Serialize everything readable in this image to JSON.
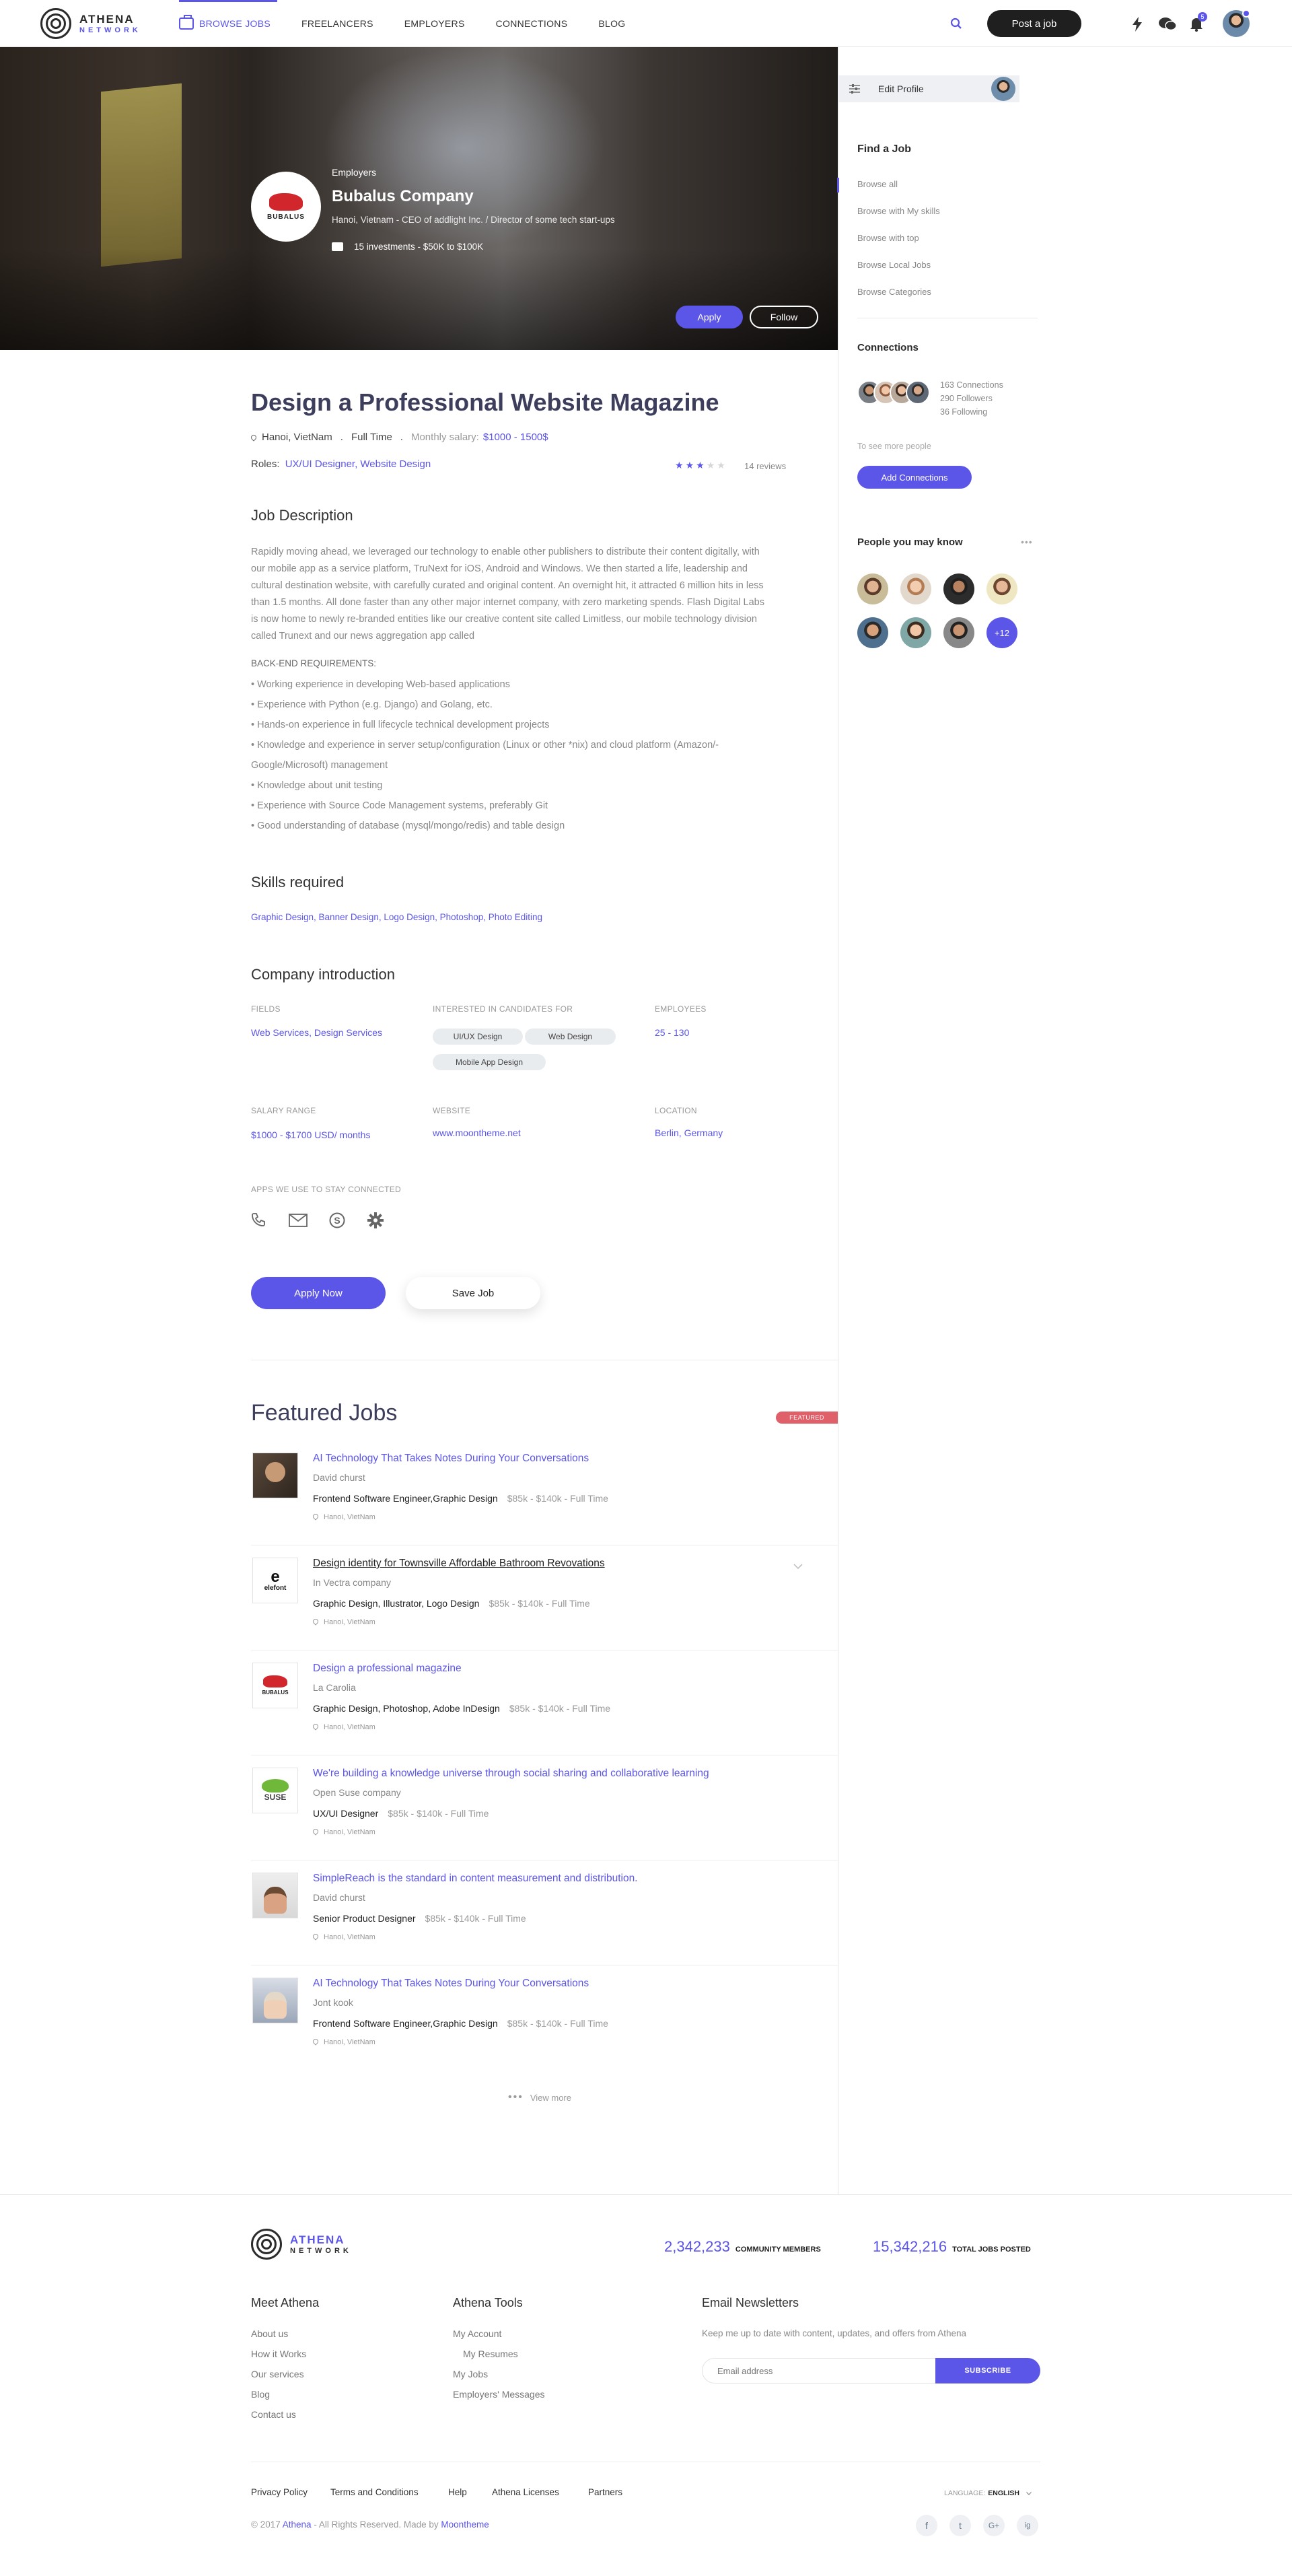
{
  "header": {
    "logo_line1": "ATHENA",
    "logo_line2": "NETWORK",
    "nav": [
      {
        "label": "BROWSE JOBS"
      },
      {
        "label": "FREELANCERS"
      },
      {
        "label": "EMPLOYERS"
      },
      {
        "label": "CONNECTIONS"
      },
      {
        "label": "BLOG"
      }
    ],
    "post_job": "Post a job",
    "notification_count": "5"
  },
  "hero": {
    "kicker": "Employers",
    "company": "Bubalus Company",
    "tagline": "Hanoi, Vietnam - CEO of addlight Inc. / Director of some tech start-ups",
    "investments": "15 investments - $50K to $100K",
    "logo_text": "BUBALUS",
    "apply": "Apply",
    "follow": "Follow"
  },
  "job": {
    "title": "Design a Professional Website Magazine",
    "location": "Hanoi, VietNam",
    "type": "Full Time",
    "salary_label": "Monthly salary:",
    "salary": "$1000 - 1500$",
    "roles_label": "Roles:",
    "roles": "UX/UI Designer, Website Design",
    "rating": 3,
    "rating_max": 5,
    "reviews": "14 reviews",
    "description_heading": "Job Description",
    "description": "Rapidly moving ahead, we leveraged our technology to enable other publishers to distribute their content digitally, with our mobile app as a service platform, TruNext for iOS, Android and Windows. We then started a life, leadership and cultural destination website, with carefully curated and original content. An overnight hit, it attracted 6 million hits in less than 1.5 months. All done faster than any other major internet company, with zero marketing spends. Flash Digital Labs is now home to newly re-branded entities like our creative content site called Limitless, our mobile technology division called Trunext and our news aggregation app called",
    "req_heading": "BACK-END REQUIREMENTS:",
    "requirements": [
      "• Working experience in developing Web-based applications",
      "• Experience with Python (e.g. Django) and Golang, etc.",
      "• Hands-on experience in full lifecycle technical development projects",
      "• Knowledge and experience in server setup/configuration (Linux or other *nix) and cloud platform (Amazon/-",
      "Google/Microsoft) management",
      "• Knowledge about unit testing",
      "• Experience with Source Code Management systems, preferably Git",
      "• Good understanding of database (mysql/mongo/redis) and table design"
    ],
    "skills_heading": "Skills required",
    "skills": "Graphic Design, Banner Design, Logo Design, Photoshop, Photo Editing"
  },
  "company_intro": {
    "heading": "Company introduction",
    "fields_label": "FIELDS",
    "fields": "Web Services, Design Services",
    "interested_label": "INTERESTED IN CANDIDATES FOR",
    "interested": [
      "UI/UX Design",
      "Web Design",
      "Mobile App Design"
    ],
    "employees_label": "EMPLOYEES",
    "employees": "25 - 130",
    "salary_label": "SALARY RANGE",
    "salary": "$1000 - $1700 USD/ months",
    "website_label": "WEBSITE",
    "website": "www.moontheme.net",
    "location_label": "LOCATION",
    "location": "Berlin, Germany",
    "apps_label": "APPS WE USE TO STAY CONNECTED",
    "apply_now": "Apply Now",
    "save_job": "Save Job"
  },
  "featured": {
    "heading": "Featured Jobs",
    "badge": "FEATURED",
    "view_more": "View more",
    "jobs": [
      {
        "title": "AI Technology That Takes Notes During Your Conversations",
        "company": "David churst",
        "skills": "Frontend Software Engineer,Graphic Design",
        "salary": "$85k - $140k - Full Time",
        "location": "Hanoi, VietNam"
      },
      {
        "title": "Design identity for Townsville Affordable Bathroom Revovations",
        "company": "In Vectra company",
        "skills": "Graphic Design, Illustrator, Logo Design",
        "salary": "$85k - $140k - Full Time",
        "location": "Hanoi, VietNam",
        "logo_text": "elefont"
      },
      {
        "title": "Design a professional magazine",
        "company": "La Carolia",
        "skills": "Graphic Design, Photoshop, Adobe InDesign",
        "salary": "$85k - $140k - Full Time",
        "location": "Hanoi, VietNam",
        "logo_text": "BUBALUS"
      },
      {
        "title": "We're building a knowledge universe through social sharing and collaborative learning",
        "company": "Open Suse company",
        "skills": "UX/UI Designer",
        "salary": "$85k - $140k - Full Time",
        "location": "Hanoi, VietNam",
        "logo_text": "SUSE"
      },
      {
        "title": "SimpleReach is the standard in content measurement and distribution.",
        "company": "David churst",
        "skills": "Senior Product Designer",
        "salary": "$85k - $140k - Full Time",
        "location": "Hanoi, VietNam"
      },
      {
        "title": "AI Technology That Takes Notes During Your Conversations",
        "company": "Jont kook",
        "skills": "Frontend Software Engineer,Graphic Design",
        "salary": "$85k - $140k - Full Time",
        "location": "Hanoi, VietNam"
      }
    ]
  },
  "sidebar": {
    "edit_profile": "Edit Profile",
    "find_job_heading": "Find a Job",
    "find_job_links": [
      "Browse all",
      "Browse with My skills",
      "Browse with top",
      "Browse Local Jobs",
      "Browse Categories"
    ],
    "connections_heading": "Connections",
    "connections": "163 Connections",
    "followers": "290 Followers",
    "following": "36 Following",
    "see_more": "To see more people",
    "add_connections": "Add Connections",
    "people_heading": "People you may know",
    "people_more": "+12"
  },
  "footer": {
    "logo_line1": "ATHENA",
    "logo_line2": "NETWORK",
    "members_count": "2,342,233",
    "members_label": "COMMUNITY MEMBERS",
    "jobs_count": "15,342,216",
    "jobs_label": "TOTAL JOBS POSTED",
    "meet_heading": "Meet Athena",
    "meet_links": [
      "About us",
      "How it Works",
      "Our services",
      "Blog",
      "Contact us"
    ],
    "tools_heading": "Athena Tools",
    "tools_links": [
      "My Account",
      "My Resumes",
      "My Jobs",
      "Employers' Messages"
    ],
    "newsletter_heading": "Email Newsletters",
    "newsletter_text": "Keep me up to date with content, updates, and offers from Athena",
    "email_placeholder": "Email address",
    "subscribe": "SUBSCRIBE",
    "bottom_links": [
      "Privacy Policy",
      "Terms and Conditions",
      "Help",
      "Athena Licenses",
      "Partners"
    ],
    "language_label": "LANGUAGE:",
    "language": "ENGLISH",
    "copyright_prefix": "© 2017",
    "copyright_brand": "Athena",
    "copyright_mid": "- All Rights Reserved. Made by",
    "copyright_maker": "Moontheme",
    "social": [
      "f",
      "t",
      "G+",
      "ig"
    ]
  },
  "colors": {
    "accent": "#5b55e8",
    "dark": "#1f1f1f",
    "badge_red": "#e0606a"
  }
}
